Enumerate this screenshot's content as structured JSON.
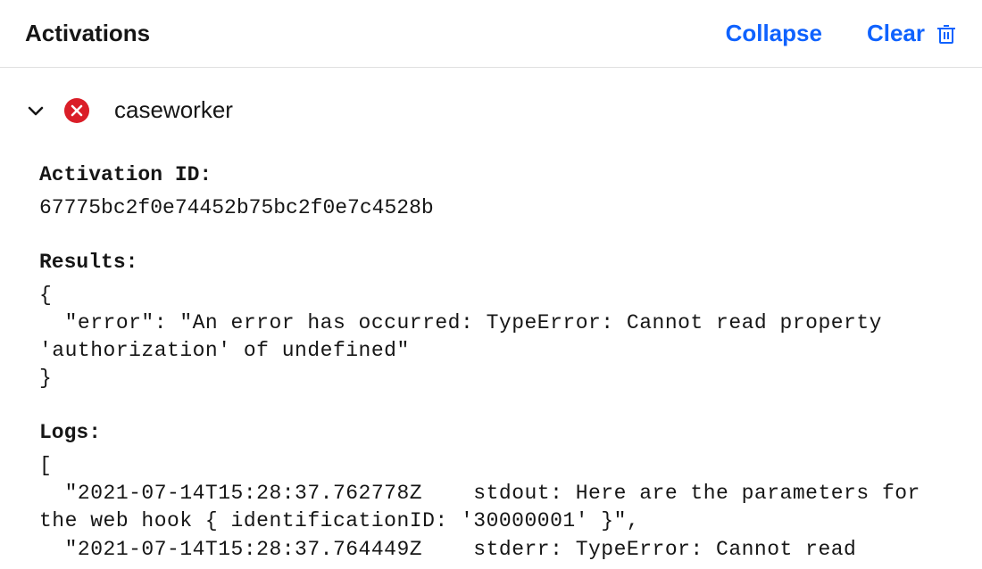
{
  "header": {
    "title": "Activations",
    "collapse_label": "Collapse",
    "clear_label": "Clear"
  },
  "activation": {
    "name": "caseworker",
    "status": "error",
    "id_label": "Activation ID:",
    "id_value": "67775bc2f0e74452b75bc2f0e7c4528b",
    "results_label": "Results:",
    "results_json": "{\n  \"error\": \"An error has occurred: TypeError: Cannot read property 'authorization' of undefined\"\n}",
    "logs_label": "Logs:",
    "logs_text": "[\n  \"2021-07-14T15:28:37.762778Z    stdout: Here are the parameters for the web hook { identificationID: '30000001' }\",\n  \"2021-07-14T15:28:37.764449Z    stderr: TypeError: Cannot read"
  }
}
